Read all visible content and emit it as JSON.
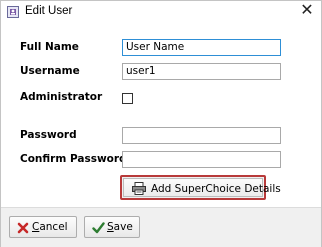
{
  "window": {
    "title": "Edit User",
    "close_glyph": "✕"
  },
  "form": {
    "full_name_label": "Full Name",
    "full_name_value": "User Name",
    "username_label": "Username",
    "username_value": "user1",
    "administrator_label": "Administrator",
    "administrator_checked": false,
    "password_label": "Password",
    "password_value": "",
    "confirm_password_label": "Confirm Password",
    "confirm_password_value": ""
  },
  "supers": {
    "button_label": "Add SuperChoice Details",
    "icon": "printer-icon",
    "highlight_color": "#b83a3a"
  },
  "footer": {
    "cancel_mnemonic": "C",
    "cancel_rest": "ancel",
    "cancel_icon": "red-x-icon",
    "save_mnemonic": "S",
    "save_rest": "ave",
    "save_icon": "green-check-icon"
  },
  "colors": {
    "focus_border": "#2e8fd6",
    "cancel_x": "#c62828",
    "save_check": "#2e7d32"
  }
}
